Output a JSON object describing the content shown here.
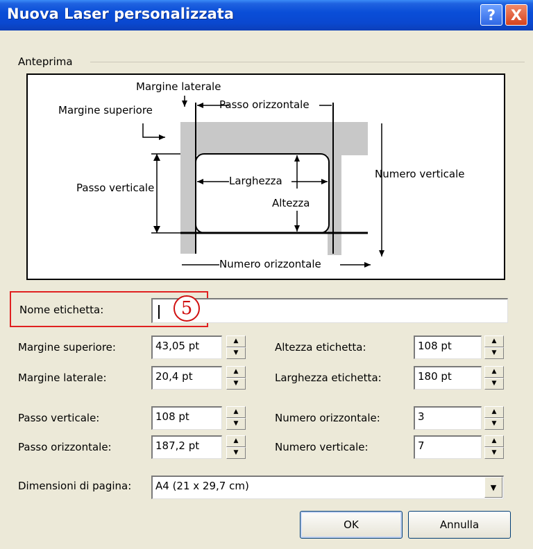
{
  "window": {
    "title": "Nuova Laser personalizzata",
    "help_icon": "?",
    "close_icon": "X"
  },
  "preview": {
    "group_label": "Anteprima",
    "margine_laterale": "Margine laterale",
    "margine_superiore": "Margine superiore",
    "passo_orizzontale": "Passo orizzontale",
    "passo_verticale": "Passo verticale",
    "larghezza": "Larghezza",
    "altezza": "Altezza",
    "numero_verticale": "Numero verticale",
    "numero_orizzontale": "Numero orizzontale"
  },
  "form": {
    "nome_etichetta": {
      "label": "Nome etichetta:",
      "value": ""
    },
    "step_marker": "5",
    "margine_superiore": {
      "label": "Margine superiore:",
      "value": "43,05 pt"
    },
    "margine_laterale": {
      "label": "Margine laterale:",
      "value": "20,4 pt"
    },
    "passo_verticale": {
      "label": "Passo verticale:",
      "value": "108 pt"
    },
    "passo_orizzontale": {
      "label": "Passo orizzontale:",
      "value": "187,2 pt"
    },
    "altezza_etichetta": {
      "label": "Altezza etichetta:",
      "value": "108 pt"
    },
    "larghezza_etichetta": {
      "label": "Larghezza etichetta:",
      "value": "180 pt"
    },
    "numero_orizzontale": {
      "label": "Numero orizzontale:",
      "value": "3"
    },
    "numero_verticale": {
      "label": "Numero verticale:",
      "value": "7"
    },
    "dimensioni_pagina": {
      "label": "Dimensioni di pagina:",
      "value": "A4 (21 x 29,7 cm)"
    }
  },
  "buttons": {
    "ok": "OK",
    "cancel": "Annulla"
  },
  "icons": {
    "spin_up": "up-arrow-icon",
    "spin_down": "down-arrow-icon",
    "dropdown": "chevron-down-icon"
  },
  "colors": {
    "titlebar": "#0a4ed8",
    "highlight": "#e02020",
    "dialog_bg": "#ece9d8"
  }
}
